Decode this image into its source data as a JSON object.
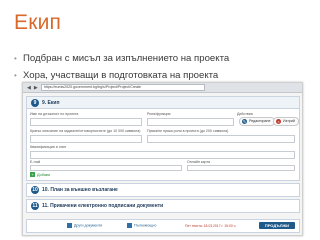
{
  "slide": {
    "title": "Екип",
    "bullets": [
      "Подбран с мисъл за изпълнението на проекта",
      "Хора, участващи в подготовката на проекта"
    ]
  },
  "browser": {
    "url": "https://eumis2020.government.bg/bg/s/Project/Project/Create"
  },
  "form": {
    "section9": {
      "number": "9",
      "title": "9. Екип",
      "fields": {
        "name_label": "Име на длъжност по проекта",
        "role_label": "Роля/функция",
        "actions_label": "Действия",
        "detail1_label": "Кратко описание на задачите/отговорностите (до 10 000 символа)",
        "detail2_label": "Пряка/не пряка роля в проекта (до 200 символа)",
        "detail3_label": "Квалификация и опит",
        "email_label": "E-mail",
        "phone_label": "Онлайн карта"
      },
      "edit_button": "Редактиране",
      "delete_button": "Изтрий",
      "add_link": "Добави"
    },
    "section10": {
      "number": "10",
      "title": "10. План за външно възлагане"
    },
    "section11": {
      "number": "11",
      "title": "11. Прикачени електронно подписани документи",
      "doc_link_1": "Други документи",
      "doc_link_2": "Пълномощно",
      "note": "Пет текста: 18.03.2017 г. 15:00 ч.",
      "submit_button": "ПРОДЪЛЖИ"
    }
  }
}
